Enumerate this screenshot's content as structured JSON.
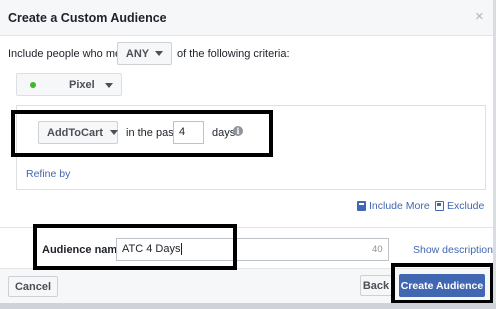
{
  "dialog": {
    "title": "Create a Custom Audience",
    "close_glyph": "×"
  },
  "criteria": {
    "prefix": "Include people who meet",
    "match_value": "ANY",
    "suffix": "of the following criteria:"
  },
  "source": {
    "label": "Pixel",
    "status_color": "#42b72a"
  },
  "rule": {
    "event": "AddToCart",
    "in_the_past_label": "in the past",
    "days_value": "4",
    "days_label": "days",
    "info_glyph": "i",
    "refine_label": "Refine by"
  },
  "actions": {
    "include_more": "Include More",
    "exclude": "Exclude"
  },
  "audience": {
    "name_label": "Audience name",
    "name_value": "ATC 4 Days",
    "char_count": "40",
    "show_description": "Show description"
  },
  "footer": {
    "cancel": "Cancel",
    "back": "Back",
    "create": "Create Audience"
  },
  "colors": {
    "link": "#4267b2",
    "primary_button": "#4267b2",
    "highlight_border": "#000000"
  }
}
